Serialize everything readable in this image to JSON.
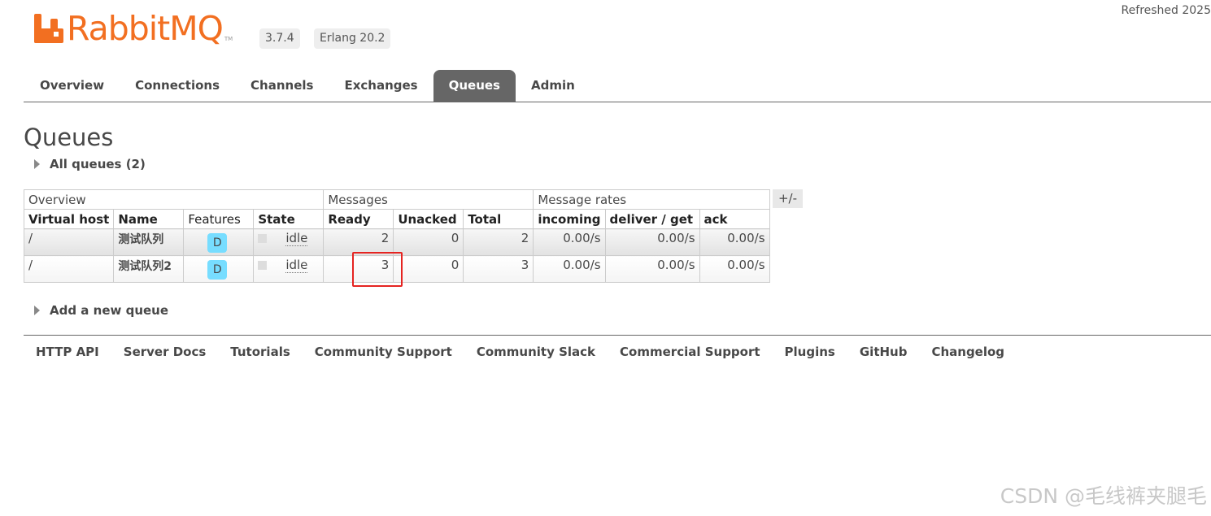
{
  "header": {
    "brand": "RabbitMQ",
    "trademark": "TM",
    "version": "3.7.4",
    "erlang": "Erlang 20.2",
    "refreshed": "Refreshed 2025",
    "brand_color": "#f26f21"
  },
  "tabs": [
    {
      "label": "Overview",
      "active": false
    },
    {
      "label": "Connections",
      "active": false
    },
    {
      "label": "Channels",
      "active": false
    },
    {
      "label": "Exchanges",
      "active": false
    },
    {
      "label": "Queues",
      "active": true
    },
    {
      "label": "Admin",
      "active": false
    }
  ],
  "page": {
    "title": "Queues",
    "all_queues": "All queues (2)",
    "add_queue": "Add a new queue"
  },
  "table": {
    "groups": [
      "Overview",
      "Messages",
      "Message rates"
    ],
    "columns": [
      "Virtual host",
      "Name",
      "Features",
      "State",
      "Ready",
      "Unacked",
      "Total",
      "incoming",
      "deliver / get",
      "ack"
    ],
    "plus_minus": "+/-",
    "rows": [
      {
        "vhost": "/",
        "name": "测试队列",
        "feature": "D",
        "state": "idle",
        "ready": "2",
        "unacked": "0",
        "total": "2",
        "incoming": "0.00/s",
        "deliver_get": "0.00/s",
        "ack": "0.00/s"
      },
      {
        "vhost": "/",
        "name": "测试队列2",
        "feature": "D",
        "state": "idle",
        "ready": "3",
        "unacked": "0",
        "total": "3",
        "incoming": "0.00/s",
        "deliver_get": "0.00/s",
        "ack": "0.00/s"
      }
    ]
  },
  "footer": {
    "links": [
      "HTTP API",
      "Server Docs",
      "Tutorials",
      "Community Support",
      "Community Slack",
      "Commercial Support",
      "Plugins",
      "GitHub",
      "Changelog"
    ]
  },
  "watermark": "CSDN @毛线裤夹腿毛",
  "colors": {
    "highlight": "#e52421",
    "feature_badge": "#77ddff",
    "active_tab": "#666666"
  }
}
